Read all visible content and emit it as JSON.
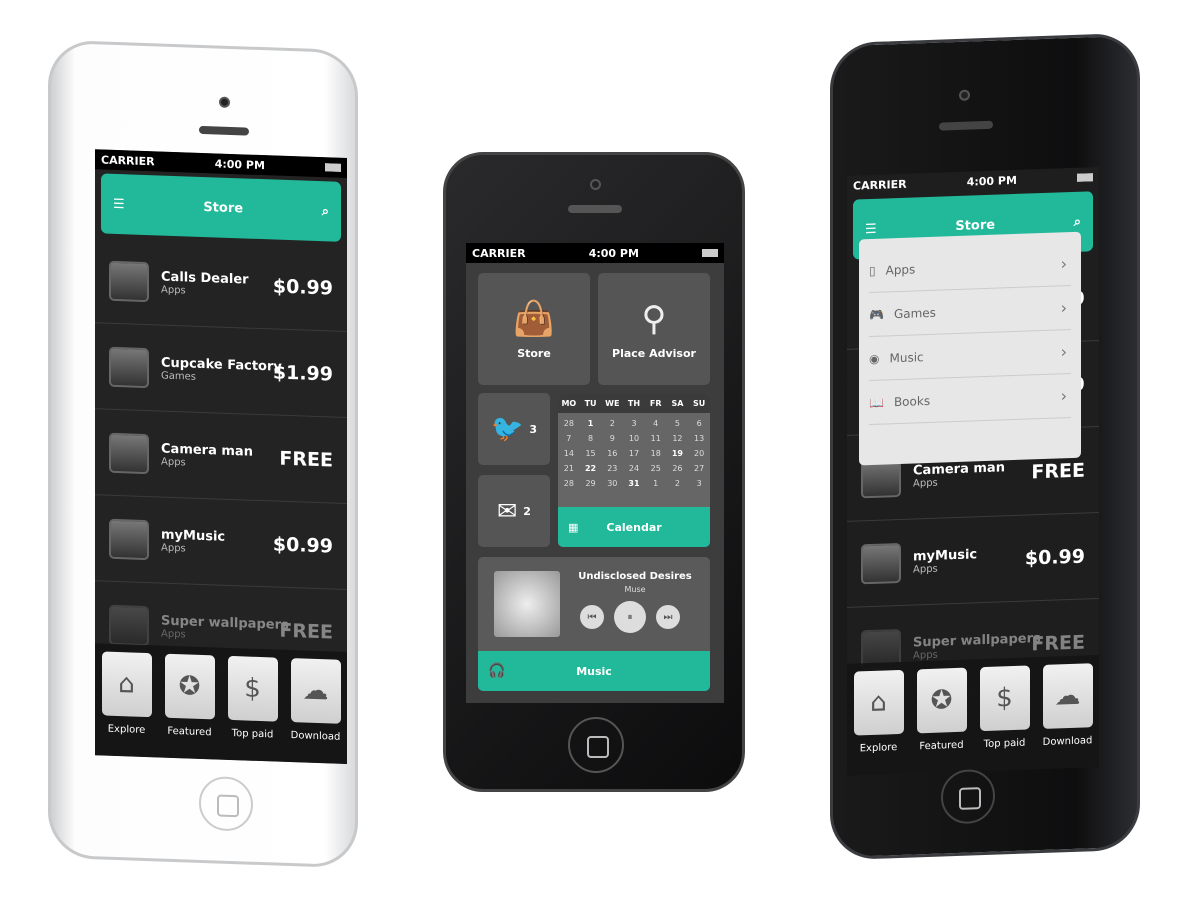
{
  "status": {
    "carrier": "CARRIER",
    "time": "4:00 PM"
  },
  "store": {
    "title": "Store",
    "items": [
      {
        "name": "Calls Dealer",
        "category": "Apps",
        "price": "$0.99"
      },
      {
        "name": "Cupcake Factory",
        "category": "Games",
        "price": "$1.99"
      },
      {
        "name": "Camera man",
        "category": "Apps",
        "price": "FREE"
      },
      {
        "name": "myMusic",
        "category": "Apps",
        "price": "$0.99"
      },
      {
        "name": "Super wallpapers",
        "category": "Apps",
        "price": "FREE"
      }
    ],
    "tabs": [
      {
        "label": "Explore",
        "icon": "home-icon"
      },
      {
        "label": "Featured",
        "icon": "star-icon"
      },
      {
        "label": "Top paid",
        "icon": "money-bag-icon"
      },
      {
        "label": "Download",
        "icon": "cloud-download-icon"
      }
    ]
  },
  "dashboard": {
    "store_label": "Store",
    "place_label": "Place Advisor",
    "twitter_count": "3",
    "mail_count": "2",
    "calendar": {
      "label": "Calendar",
      "weekdays": [
        "MO",
        "TU",
        "WE",
        "TH",
        "FR",
        "SA",
        "SU"
      ],
      "days": [
        "28",
        "1",
        "2",
        "3",
        "4",
        "5",
        "6",
        "7",
        "8",
        "9",
        "10",
        "11",
        "12",
        "13",
        "14",
        "15",
        "16",
        "17",
        "18",
        "19",
        "20",
        "21",
        "22",
        "23",
        "24",
        "25",
        "26",
        "27",
        "28",
        "29",
        "30",
        "31",
        "1",
        "2",
        "3"
      ],
      "highlighted": [
        "1",
        "19",
        "22",
        "31"
      ]
    },
    "music": {
      "label": "Music",
      "track": "Undisclosed Desires",
      "artist": "Muse"
    }
  },
  "menu": {
    "items": [
      {
        "label": "Apps",
        "icon": "phone-icon"
      },
      {
        "label": "Games",
        "icon": "gamepad-icon"
      },
      {
        "label": "Music",
        "icon": "speaker-icon"
      },
      {
        "label": "Books",
        "icon": "book-icon"
      }
    ]
  },
  "colors": {
    "accent": "#21b99a"
  }
}
